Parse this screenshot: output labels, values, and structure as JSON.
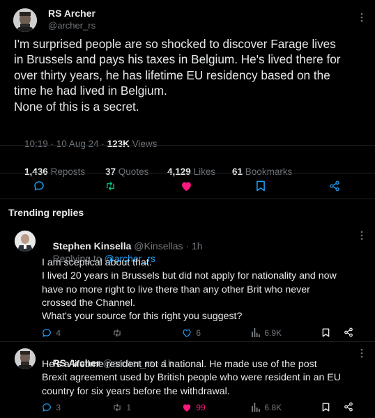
{
  "main_post": {
    "author_name": "RS Archer",
    "author_handle": "@archer_rs",
    "text_lines": [
      "I'm surprised people are so shocked to discover Farage lives",
      "in Brussels and pays his taxes in Belgium.  He's lived there for",
      "over thirty years, he has lifetime EU residency based on the",
      "time he had lived in Belgium.",
      "None of  this is a secret."
    ],
    "time": "10:19 · 10 Aug 24 · ",
    "views_count": "123K",
    "views_label": " Views",
    "stats": {
      "reposts_count": "1,436",
      "reposts_label": " Reposts",
      "quotes_count": "37",
      "quotes_label": " Quotes",
      "likes_count": "4,129",
      "likes_label": " Likes",
      "bookmarks_count": "61",
      "bookmarks_label": " Bookmarks"
    }
  },
  "section_title": "Trending replies",
  "replies": [
    {
      "author_name": "Stephen Kinsella",
      "author_handle": "@Kinsellas · 1h",
      "replying_prefix": "Replying to ",
      "replying_handle": "@archer_rs",
      "text_lines": [
        "I am sceptical about that.",
        "I lived 20 years in Brussels but did not apply for nationality and now",
        "have no more right to live there than any other Brit who never",
        "crossed the Channel.",
        "What's your source for this right you suggest?"
      ],
      "reply_count": "4",
      "repost_count": "",
      "like_count": "6",
      "view_count": "6.9K"
    },
    {
      "author_name": "RS Archer",
      "author_handle": "@archer_rs · 1h",
      "text_lines": [
        "He's a lifetime resident not a national.  He made use of the post",
        "Brexit agreement used by British people who were resident in an EU",
        "country for six years before the withdrawal."
      ],
      "reply_count": "3",
      "repost_count": "1",
      "like_count": "99",
      "view_count": "6.8K"
    }
  ],
  "colors": {
    "accent": "#1d9bf0",
    "like": "#f91880",
    "repost": "#00ba7c",
    "muted": "#71767b",
    "text": "#e7e9ea"
  }
}
